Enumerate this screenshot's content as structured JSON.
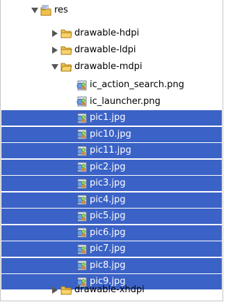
{
  "tree": {
    "root": {
      "label": "res",
      "icon": "resource-folder-icon",
      "expanded": true
    },
    "children": [
      {
        "label": "drawable-hdpi",
        "icon": "folder-icon",
        "expanded": false
      },
      {
        "label": "drawable-ldpi",
        "icon": "folder-icon",
        "expanded": false
      },
      {
        "label": "drawable-mdpi",
        "icon": "folder-icon",
        "expanded": true,
        "files": [
          {
            "label": "ic_action_search.png",
            "icon": "image-file-icon",
            "selected": false
          },
          {
            "label": "ic_launcher.png",
            "icon": "image-file-icon",
            "selected": false
          },
          {
            "label": "pic1.jpg",
            "icon": "image-file-icon",
            "selected": true
          },
          {
            "label": "pic10.jpg",
            "icon": "image-file-icon",
            "selected": true
          },
          {
            "label": "pic11.jpg",
            "icon": "image-file-icon",
            "selected": true
          },
          {
            "label": "pic2.jpg",
            "icon": "image-file-icon",
            "selected": true
          },
          {
            "label": "pic3.jpg",
            "icon": "image-file-icon",
            "selected": true
          },
          {
            "label": "pic4.jpg",
            "icon": "image-file-icon",
            "selected": true
          },
          {
            "label": "pic5.jpg",
            "icon": "image-file-icon",
            "selected": true
          },
          {
            "label": "pic6.jpg",
            "icon": "image-file-icon",
            "selected": true
          },
          {
            "label": "pic7.jpg",
            "icon": "image-file-icon",
            "selected": true
          },
          {
            "label": "pic8.jpg",
            "icon": "image-file-icon",
            "selected": true
          },
          {
            "label": "pic9.jpg",
            "icon": "image-file-icon",
            "selected": true
          }
        ]
      },
      {
        "label": "drawable-xhdpi",
        "icon": "folder-icon",
        "expanded": false
      }
    ]
  },
  "colors": {
    "selection": "#3b62c6",
    "folder": "#e9b23a",
    "arrow": "#555555"
  }
}
